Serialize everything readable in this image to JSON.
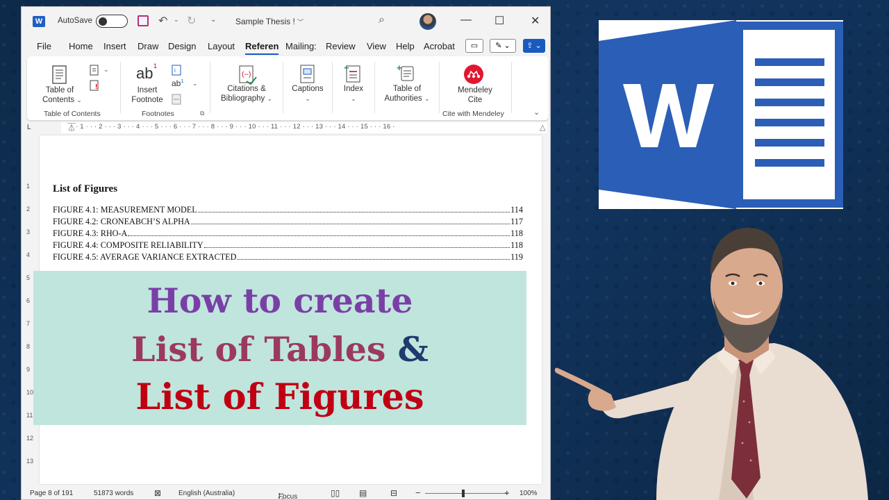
{
  "window": {
    "autosave_label": "AutoSave",
    "doc_title": "Sample Thesis !",
    "app_logo_letter": "W"
  },
  "tabs": [
    "File",
    "Home",
    "Insert",
    "Draw",
    "Design",
    "Layout",
    "Referen",
    "Mailing:",
    "Review",
    "View",
    "Help",
    "Acrobat"
  ],
  "ribbon": {
    "toc_label_1": "Table of",
    "toc_label_2": "Contents",
    "toc_group": "Table of Contents",
    "footnote_icon": "ab",
    "footnote_label_1": "Insert",
    "footnote_label_2": "Footnote",
    "footnote_group": "Footnotes",
    "citations_label_1": "Citations &",
    "citations_label_2": "Bibliography",
    "captions_label": "Captions",
    "index_label": "Index",
    "toa_label_1": "Table of",
    "toa_label_2": "Authorities",
    "mendeley_label_1": "Mendeley",
    "mendeley_label_2": "Cite",
    "mendeley_group": "Cite with Mendeley"
  },
  "ruler": {
    "horizontal": "· 1 · · · 2 · · · 3 · · · 4 · · · 5 · · · 6 · · · 7 · · · 8 · · · 9 · · · 10 · · · 11 · · · 12 · · · 13 · · · 14 · · · 15 · · · 16 ·",
    "vertical": [
      "1",
      "2",
      "3",
      "4",
      "5",
      "6",
      "7",
      "8",
      "9",
      "10",
      "11",
      "12",
      "13"
    ]
  },
  "document": {
    "heading": "List of Figures",
    "figures": [
      {
        "label": "FIGURE 4.1: MEASUREMENT MODEL",
        "page": "114"
      },
      {
        "label": "FIGURE 4.2: CRONEABCH’S ALPHA",
        "page": "117"
      },
      {
        "label": "FIGURE 4.3: RHO-A",
        "page": "118"
      },
      {
        "label": "FIGURE 4.4: COMPOSITE RELIABILITY",
        "page": "118"
      },
      {
        "label": "FIGURE 4.5: AVERAGE VARIANCE EXTRACTED",
        "page": "119"
      }
    ]
  },
  "status": {
    "page": "Page 8 of 191",
    "words": "51873 words",
    "language": "English (Australia)",
    "focus": "Focus",
    "zoom": "100%"
  },
  "banner": {
    "line1": "How to create",
    "line2": "List of Tables",
    "line2_amp": "&",
    "line3": "List of Figures"
  },
  "colors": {
    "word_blue": "#185abd",
    "banner_bg": "#bfe5dd",
    "line1": "#7a3fa6",
    "line2": "#9a3a5e",
    "amp": "#1f3a6f",
    "line3": "#c00012"
  }
}
